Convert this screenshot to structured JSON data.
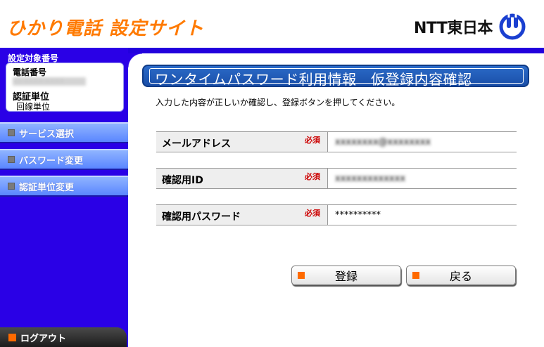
{
  "header": {
    "site_title": "ひかり電話 設定サイト",
    "brand_text": "NTT東日本"
  },
  "sidebar": {
    "target_label": "設定対象番号",
    "phone_label": "電話番号",
    "phone_value": "03-XXXX-XXXX",
    "unit_label": "認証単位",
    "unit_value": "回線単位",
    "nav": [
      {
        "label": "サービス選択"
      },
      {
        "label": "パスワード変更"
      },
      {
        "label": "認証単位変更"
      }
    ],
    "logout_label": "ログアウト"
  },
  "main": {
    "title": "ワンタイムパスワード利用情報　仮登録内容確認",
    "instruction": "入力した内容が正しいか確認し、登録ボタンを押してください。",
    "required_label": "必須",
    "rows": [
      {
        "label": "メールアドレス",
        "value": "xxxxxxxx@xxxxxxxx"
      },
      {
        "label": "確認用ID",
        "value": "xxxxxxxxxxxxx"
      },
      {
        "label": "確認用パスワード",
        "value": "**********"
      }
    ],
    "buttons": {
      "register": "登録",
      "back": "戻る"
    }
  },
  "colors": {
    "title_orange": "#ff7a00",
    "sidebar_blue": "#2a00e6",
    "required_red": "#cc0000"
  }
}
